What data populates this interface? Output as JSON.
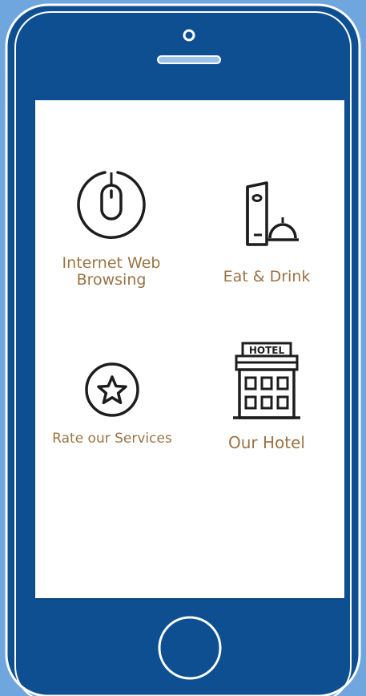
{
  "phone": {
    "frame_color": "#0e4f92",
    "background_color": "#6fa6de"
  },
  "tiles": [
    {
      "label_line1": "Internet Web",
      "label_line2": "Browsing",
      "icon": "mouse-icon"
    },
    {
      "label": "Eat & Drink",
      "icon": "menu-and-cloche-icon"
    },
    {
      "label": "Rate our Services",
      "icon": "star-icon"
    },
    {
      "label": "Our Hotel",
      "icon": "hotel-building-icon",
      "sign_text": "HOTEL"
    }
  ],
  "colors": {
    "label_color": "#9a7346",
    "icon_color": "#1d1d1d"
  }
}
